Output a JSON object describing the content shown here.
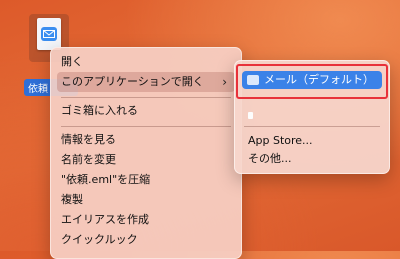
{
  "desktop": {
    "file": {
      "name": "依頼"
    }
  },
  "context_menu": {
    "items": [
      {
        "label": "開く"
      },
      {
        "label": "このアプリケーションで開く",
        "chevron": "›"
      },
      {
        "label": "ゴミ箱に入れる"
      },
      {
        "label": "情報を見る"
      },
      {
        "label": "名前を変更"
      },
      {
        "label": "\"依頼.eml\"を圧縮"
      },
      {
        "label": "複製"
      },
      {
        "label": "エイリアスを作成"
      },
      {
        "label": "クイックルック"
      }
    ]
  },
  "submenu": {
    "default_app": "メール（デフォルト）",
    "app_store": "App Store...",
    "other": "その他..."
  },
  "colors": {
    "highlight": "#3b82e8",
    "annotation_border": "#e8313a"
  }
}
